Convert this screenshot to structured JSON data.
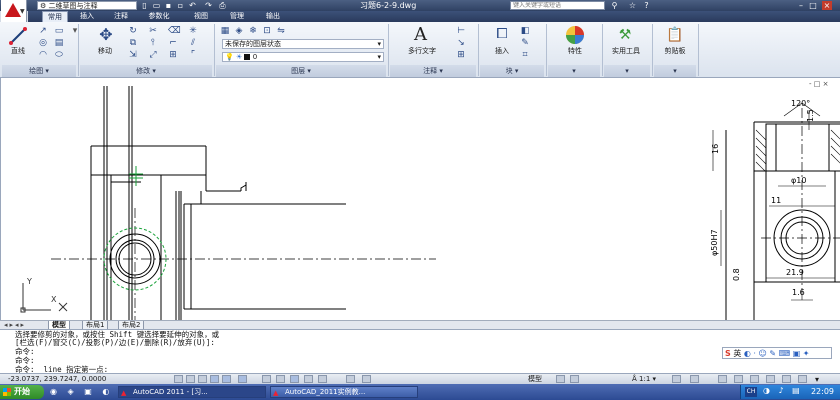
{
  "titlebar": {
    "workspace": "二维草图与注释",
    "file_title": "习题6-2-9.dwg",
    "search_placeholder": "键入关键字或短语"
  },
  "tabs": [
    "常用",
    "插入",
    "注释",
    "参数化",
    "视图",
    "管理",
    "输出"
  ],
  "ribbon": {
    "draw": {
      "big_label": "直线",
      "panel_label": "绘图"
    },
    "modify": {
      "big_label": "移动",
      "panel_label": "修改"
    },
    "layers": {
      "state_value": "未保存的图层状态",
      "current_layer": "0",
      "panel_label": "图层"
    },
    "annotation": {
      "big_label": "多行文字",
      "panel_label": "注释"
    },
    "block": {
      "big_label": "插入",
      "panel_label": "块"
    },
    "properties": {
      "big_label": "特性"
    },
    "utilities": {
      "big_label": "实用工具"
    },
    "clipboard": {
      "big_label": "剪贴板"
    }
  },
  "drawing": {
    "dimensions": [
      "120°",
      "1.5",
      "16",
      "φ10",
      "11",
      "φ50H7",
      "21.9",
      "0.8",
      "1.6"
    ],
    "ucs": {
      "x": "X",
      "y": "Y"
    }
  },
  "layout_tabs": [
    "模型",
    "布局1",
    "布局2"
  ],
  "command": {
    "lines": [
      "选择要修剪的对象，或按住 Shift 键选择要延伸的对象，或",
      "[栏选(F)/窗交(C)/投影(P)/边(E)/删除(R)/放弃(U)]:",
      "命令:",
      "命令:",
      "命令: _line 指定第一点:"
    ],
    "ime_label": "英"
  },
  "statusbar": {
    "coords": "-23.0737, 239.7247, 0.0000",
    "space": "模型",
    "scale": "1:1"
  },
  "taskbar": {
    "start": "开始",
    "tasks": [
      "AutoCAD 2011 - [习...",
      "AutoCAD_2011实例教..."
    ],
    "clock": "22:09",
    "lang": "CH"
  },
  "colors": {
    "accent": "#2c4a93",
    "logo": "#c8171c",
    "title": "#2f4163"
  }
}
